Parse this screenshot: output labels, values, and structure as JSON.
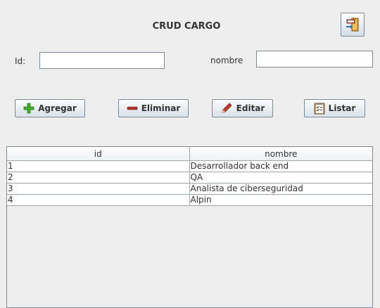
{
  "header": {
    "title": "CRUD CARGO",
    "exit_icon": "exit-door-icon"
  },
  "form": {
    "id_label": "Id:",
    "id_value": "",
    "nombre_label": "nombre",
    "nombre_value": ""
  },
  "toolbar": {
    "agregar_label": "Agregar",
    "eliminar_label": "Eliminar",
    "editar_label": "Editar",
    "listar_label": "Listar",
    "colors": {
      "plus": "#3fae2a",
      "minus": "#b0342c",
      "pencil": "#c83a2a"
    }
  },
  "table": {
    "columns": [
      "id",
      "nombre"
    ],
    "rows": [
      [
        "1",
        "Desarrollador back end"
      ],
      [
        "2",
        "QA"
      ],
      [
        "3",
        "Analista de ciberseguridad"
      ],
      [
        "4",
        "Alpin"
      ]
    ]
  }
}
